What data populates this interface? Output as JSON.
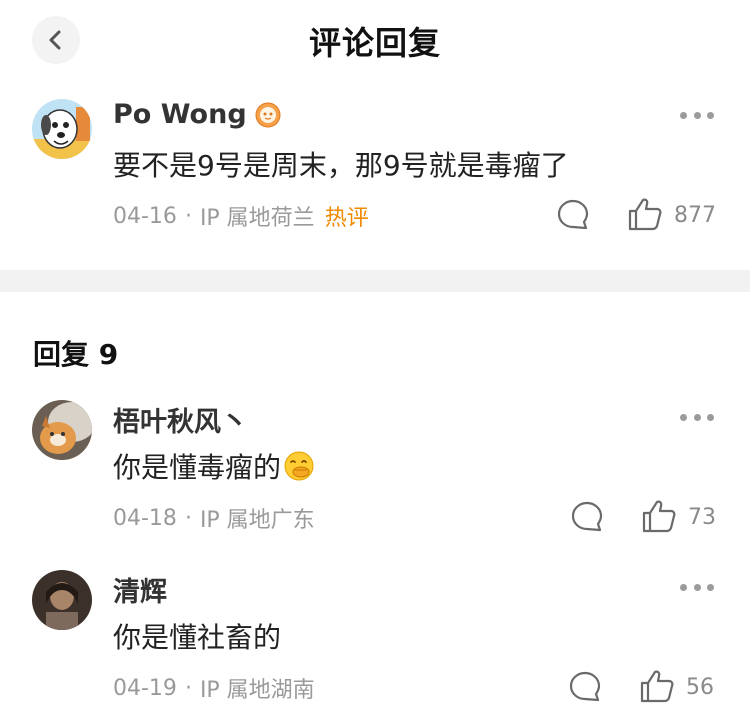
{
  "header": {
    "title": "评论回复",
    "back_icon": "chevron-left-icon"
  },
  "main_comment": {
    "user": "Po Wong",
    "text": "要不是9号是周末，那9号就是毒瘤了",
    "date": "04-16",
    "ip": "IP 属地荷兰",
    "hot_label": "热评",
    "likes": "877"
  },
  "replies_section": {
    "title": "回复 9"
  },
  "replies": [
    {
      "user": "梧叶秋风丶",
      "text": "你是懂毒瘤的",
      "emoji": "covering-mouth-laugh-emoji",
      "date": "04-18",
      "ip": "IP 属地广东",
      "likes": "73"
    },
    {
      "user": "清辉",
      "text": "你是懂社畜的",
      "date": "04-19",
      "ip": "IP 属地湖南",
      "likes": "56"
    }
  ],
  "colors": {
    "hot": "#f08a00",
    "divider": "#f2f2f2",
    "meta": "#9a9a9a"
  }
}
